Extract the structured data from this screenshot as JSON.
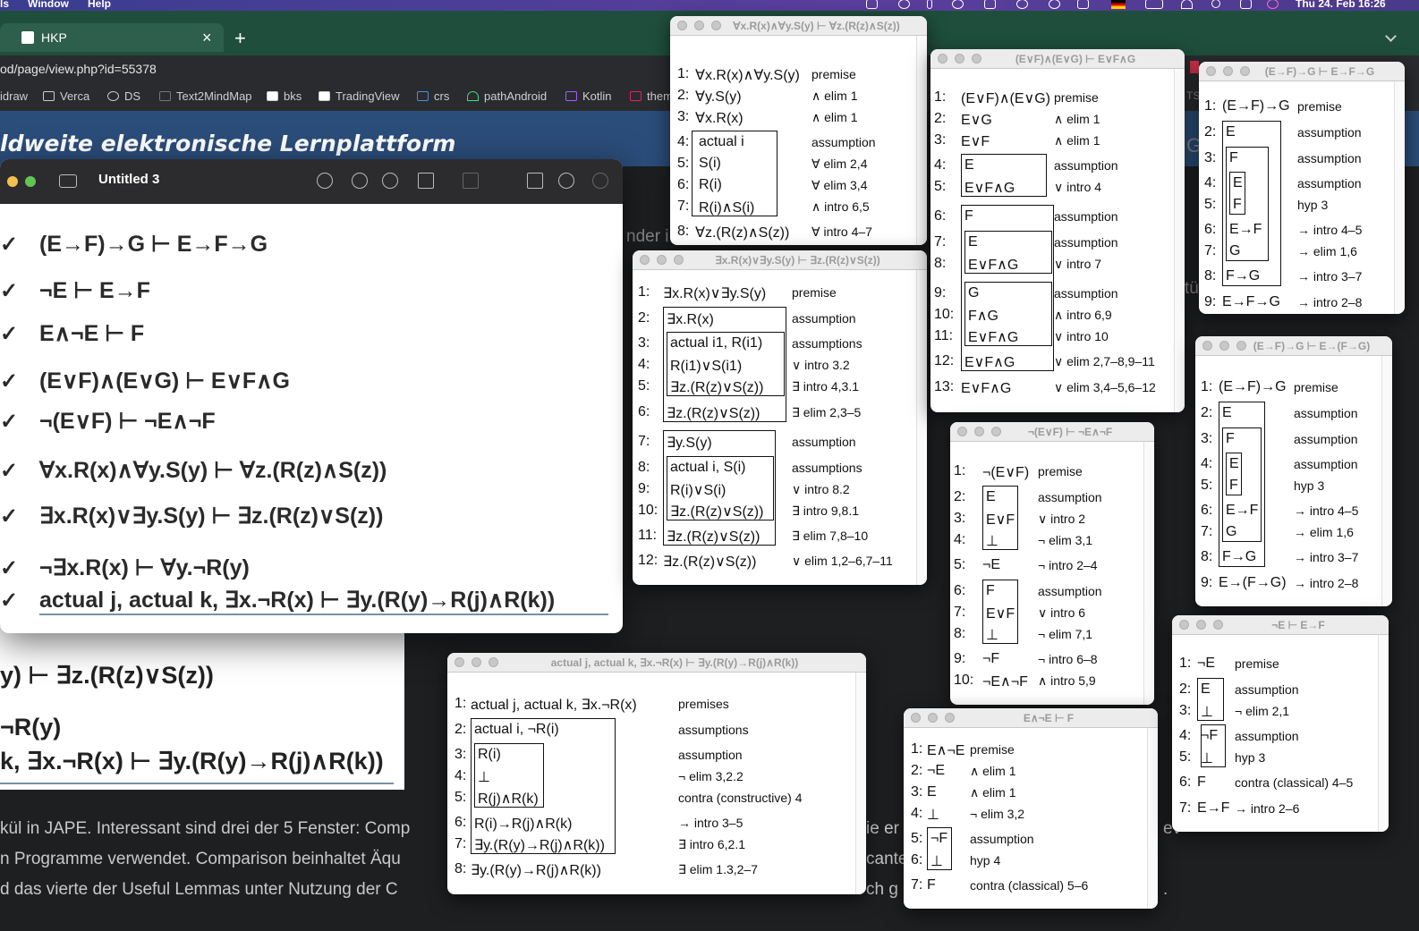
{
  "menubar": {
    "items": [
      "ls",
      "Window",
      "Help"
    ],
    "clock": "Thu 24. Feb  16:26"
  },
  "browser": {
    "tab_title": "HKP",
    "tab_close": "×",
    "new_tab": "+",
    "url": "od/page/view.php?id=55378",
    "bookmarks": [
      "idraw",
      "Verca",
      "DS",
      "Text2MindMap",
      "bks",
      "TradingView",
      "crs",
      "pathAndroid",
      "Kotlin",
      "them"
    ],
    "site_title": "ldweite elektronische Lernplattform",
    "ghost_texts": [
      "nder i",
      "Ga",
      "tü",
      "TS"
    ],
    "body_lines": [
      "kül in JAPE. Interessant sind drei der 5 Fenster: Comp",
      "ie er",
      "ev",
      "n Programme verwendet. Comparison beinhaltet Äqu",
      "cante",
      "d das vierte der Useful Lemmas unter Nutzung der C",
      "ch g",
      "."
    ]
  },
  "preview": {
    "title": "Untitled 3",
    "check": "✓",
    "sequents": [
      "(E→F)→G ⊢ E→F→G",
      "¬E ⊢ E→F",
      "E∧¬E ⊢ F",
      "(E∨F)∧(E∨G) ⊢ E∨F∧G",
      "¬(E∨F) ⊢ ¬E∧¬F",
      "∀x.R(x)∧∀y.S(y) ⊢ ∀z.(R(z)∧S(z))",
      "∃x.R(x)∨∃y.S(y) ⊢ ∃z.(R(z)∨S(z))",
      "¬∃x.R(x) ⊢ ∀y.¬R(y)",
      "actual j, actual k, ∃x.¬R(x) ⊢ ∃y.(R(y)→R(j)∧R(k))"
    ],
    "back_lines": [
      "y) ⊢ ∃z.(R(z)∨S(z))",
      "¬R(y)",
      "k, ∃x.¬R(x) ⊢ ∃y.(R(y)→R(j)∧R(k))"
    ]
  },
  "proofs": [
    {
      "id": "w1",
      "title": "∀x.R(x)∧∀y.S(y) ⊢ ∀z.(R(z)∧S(z))",
      "lines": [
        [
          "1:",
          "∀x.R(x)∧∀y.S(y)",
          "premise"
        ],
        [
          "2:",
          "∀y.S(y)",
          "∧ elim 1"
        ],
        [
          "3:",
          "∀x.R(x)",
          "∧ elim 1"
        ],
        [
          "4:",
          "actual i",
          "assumption"
        ],
        [
          "5:",
          "S(i)",
          "∀ elim 2,4"
        ],
        [
          "6:",
          "R(i)",
          "∀ elim 3,4"
        ],
        [
          "7:",
          "R(i)∧S(i)",
          "∧ intro 6,5"
        ],
        [
          "8:",
          "∀z.(R(z)∧S(z))",
          "∀ intro 4–7"
        ]
      ]
    },
    {
      "id": "w2",
      "title": "∃x.R(x)∨∃y.S(y) ⊢ ∃z.(R(z)∨S(z))",
      "lines": [
        [
          "1:",
          "∃x.R(x)∨∃y.S(y)",
          "premise"
        ],
        [
          "2:",
          "∃x.R(x)",
          "assumption"
        ],
        [
          "3:",
          "actual i1, R(i1)",
          "assumptions"
        ],
        [
          "4:",
          "R(i1)∨S(i1)",
          "∨ intro 3.2"
        ],
        [
          "5:",
          "∃z.(R(z)∨S(z))",
          "∃ intro 4,3.1"
        ],
        [
          "6:",
          "∃z.(R(z)∨S(z))",
          "∃ elim 2,3–5"
        ],
        [
          "7:",
          "∃y.S(y)",
          "assumption"
        ],
        [
          "8:",
          "actual i, S(i)",
          "assumptions"
        ],
        [
          "9:",
          "R(i)∨S(i)",
          "∨ intro 8.2"
        ],
        [
          "10:",
          "∃z.(R(z)∨S(z))",
          "∃ intro 9,8.1"
        ],
        [
          "11:",
          "∃z.(R(z)∨S(z))",
          "∃ elim 7,8–10"
        ],
        [
          "12:",
          "∃z.(R(z)∨S(z))",
          "∨ elim 1,2–6,7–11"
        ]
      ]
    },
    {
      "id": "w3",
      "title": "(E∨F)∧(E∨G) ⊢ E∨F∧G",
      "lines": [
        [
          "1:",
          "(E∨F)∧(E∨G)",
          "premise"
        ],
        [
          "2:",
          "E∨G",
          "∧ elim 1"
        ],
        [
          "3:",
          "E∨F",
          "∧ elim 1"
        ],
        [
          "4:",
          "E",
          "assumption"
        ],
        [
          "5:",
          "E∨F∧G",
          "∨ intro 4"
        ],
        [
          "6:",
          "F",
          "assumption"
        ],
        [
          "7:",
          "E",
          "assumption"
        ],
        [
          "8:",
          "E∨F∧G",
          "∨ intro 7"
        ],
        [
          "9:",
          "G",
          "assumption"
        ],
        [
          "10:",
          "F∧G",
          "∧ intro 6,9"
        ],
        [
          "11:",
          "E∨F∧G",
          "∨ intro 10"
        ],
        [
          "12:",
          "E∨F∧G",
          "∨ elim 2,7–8,9–11"
        ],
        [
          "13:",
          "E∨F∧G",
          "∨ elim 3,4–5,6–12"
        ]
      ]
    },
    {
      "id": "w4",
      "title": "(E→F)→G ⊢ E→F→G",
      "lines": [
        [
          "1:",
          "(E→F)→G",
          "premise"
        ],
        [
          "2:",
          "E",
          "assumption"
        ],
        [
          "3:",
          "F",
          "assumption"
        ],
        [
          "4:",
          "E",
          "assumption"
        ],
        [
          "5:",
          "F",
          "hyp 3"
        ],
        [
          "6:",
          "E→F",
          "→ intro 4–5"
        ],
        [
          "7:",
          "G",
          "→ elim 1,6"
        ],
        [
          "8:",
          "F→G",
          "→ intro 3–7"
        ],
        [
          "9:",
          "E→F→G",
          "→ intro 2–8"
        ]
      ]
    },
    {
      "id": "w5",
      "title": "(E→F)→G ⊢ E→(F→G)",
      "lines": [
        [
          "1:",
          "(E→F)→G",
          "premise"
        ],
        [
          "2:",
          "E",
          "assumption"
        ],
        [
          "3:",
          "F",
          "assumption"
        ],
        [
          "4:",
          "E",
          "assumption"
        ],
        [
          "5:",
          "F",
          "hyp 3"
        ],
        [
          "6:",
          "E→F",
          "→ intro 4–5"
        ],
        [
          "7:",
          "G",
          "→ elim 1,6"
        ],
        [
          "8:",
          "F→G",
          "→ intro 3–7"
        ],
        [
          "9:",
          "E→(F→G)",
          "→ intro 2–8"
        ]
      ]
    },
    {
      "id": "w6",
      "title": "¬(E∨F) ⊢ ¬E∧¬F",
      "lines": [
        [
          "1:",
          "¬(E∨F)",
          "premise"
        ],
        [
          "2:",
          "E",
          "assumption"
        ],
        [
          "3:",
          "E∨F",
          "∨ intro 2"
        ],
        [
          "4:",
          "⊥",
          "¬ elim 3,1"
        ],
        [
          "5:",
          "¬E",
          "¬ intro 2–4"
        ],
        [
          "6:",
          "F",
          "assumption"
        ],
        [
          "7:",
          "E∨F",
          "∨ intro 6"
        ],
        [
          "8:",
          "⊥",
          "¬ elim 7,1"
        ],
        [
          "9:",
          "¬F",
          "¬ intro 6–8"
        ],
        [
          "10:",
          "¬E∧¬F",
          "∧ intro 5,9"
        ]
      ]
    },
    {
      "id": "w7",
      "title": "actual j, actual k, ∃x.¬R(x) ⊢ ∃y.(R(y)→R(j)∧R(k))",
      "lines": [
        [
          "1:",
          "actual j, actual k, ∃x.¬R(x)",
          "premises"
        ],
        [
          "2:",
          "actual i, ¬R(i)",
          "assumptions"
        ],
        [
          "3:",
          "R(i)",
          "assumption"
        ],
        [
          "4:",
          "⊥",
          "¬ elim 3,2.2"
        ],
        [
          "5:",
          "R(j)∧R(k)",
          "contra (constructive) 4"
        ],
        [
          "6:",
          "R(i)→R(j)∧R(k)",
          "→ intro 3–5"
        ],
        [
          "7:",
          "∃y.(R(y)→R(j)∧R(k))",
          "∃ intro 6,2.1"
        ],
        [
          "8:",
          "∃y.(R(y)→R(j)∧R(k))",
          "∃ elim 1.3,2–7"
        ]
      ]
    },
    {
      "id": "w8",
      "title": "E∧¬E ⊢ F",
      "lines": [
        [
          "1:",
          "E∧¬E",
          "premise"
        ],
        [
          "2:",
          "¬E",
          "∧ elim 1"
        ],
        [
          "3:",
          "E",
          "∧ elim 1"
        ],
        [
          "4:",
          "⊥",
          "¬ elim 3,2"
        ],
        [
          "5:",
          "¬F",
          "assumption"
        ],
        [
          "6:",
          "⊥",
          "hyp 4"
        ],
        [
          "7:",
          "F",
          "contra (classical) 5–6"
        ]
      ]
    },
    {
      "id": "w9",
      "title": "¬E ⊢ E→F",
      "lines": [
        [
          "1:",
          "¬E",
          "premise"
        ],
        [
          "2:",
          "E",
          "assumption"
        ],
        [
          "3:",
          "⊥",
          "¬ elim 2,1"
        ],
        [
          "4:",
          "¬F",
          "assumption"
        ],
        [
          "5:",
          "⊥",
          "hyp 3"
        ],
        [
          "6:",
          "F",
          "contra (classical) 4–5"
        ],
        [
          "7:",
          "E→F",
          "→ intro 2–6"
        ]
      ]
    }
  ]
}
